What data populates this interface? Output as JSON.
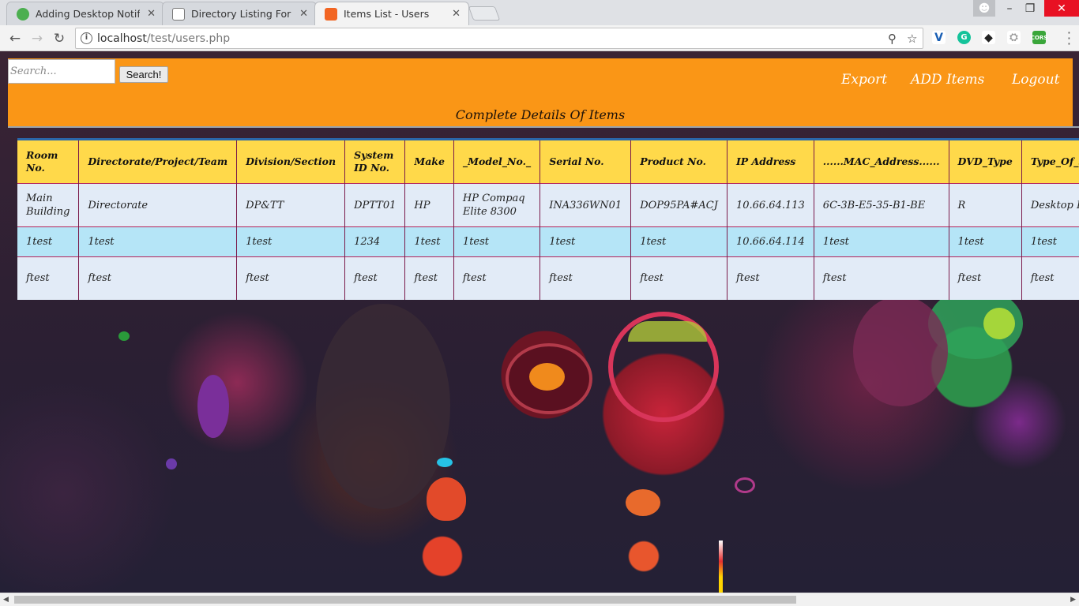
{
  "browser": {
    "tabs": [
      {
        "title": "Adding Desktop Notifica",
        "favicon_color": "#4caf50",
        "active": false
      },
      {
        "title": "Directory Listing For [/im",
        "favicon_color": "#8a8a8a",
        "active": false
      },
      {
        "title": "Items List - Users",
        "favicon_color": "#f26522",
        "active": true
      }
    ],
    "url_host": "localhost",
    "url_path": "/test/users.php",
    "window_buttons": {
      "minimize": "–",
      "maximize": "❐",
      "close": "✕"
    }
  },
  "header": {
    "search_placeholder": "Search...",
    "search_button": "Search!",
    "links": [
      "Export",
      "ADD Items",
      "Logout"
    ],
    "page_title": "Complete Details Of Items",
    "bar_color": "#fa9616"
  },
  "table": {
    "columns": [
      "Room No.",
      "Directorate/Project/Team",
      "Division/Section",
      "System ID No.",
      "Make",
      "_Model_No._",
      "Serial No.",
      "Product No.",
      "IP Address",
      "......MAC_Address......",
      "DVD_Type",
      "Type_Of_System"
    ],
    "rows": [
      [
        "Main Building",
        "Directorate",
        "DP&TT",
        "DPTT01",
        "HP",
        "HP Compaq Elite 8300",
        "INA336WN01",
        "DOP95PA#ACJ",
        "10.66.64.113",
        "6C-3B-E5-35-B1-BE",
        "R",
        "Desktop PC"
      ],
      [
        "1test",
        "1test",
        "1test",
        "1234",
        "1test",
        "1test",
        "1test",
        "1test",
        "10.66.64.114",
        "1test",
        "1test",
        "1test"
      ],
      [
        "ftest",
        "ftest",
        "ftest",
        "ftest",
        "ftest",
        "ftest",
        "ftest",
        "ftest",
        "ftest",
        "ftest",
        "ftest",
        "ftest"
      ]
    ],
    "header_color": "#ffd94a",
    "row_colors": [
      "#e2ebf7",
      "#b5e5f7",
      "#e2ebf7"
    ]
  }
}
